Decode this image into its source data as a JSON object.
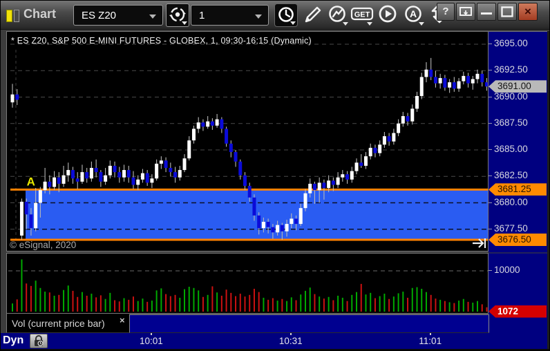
{
  "window": {
    "title": "Chart",
    "controls": {
      "help": "?",
      "close": "×"
    }
  },
  "toolbar": {
    "symbol": "ES Z20",
    "interval": "1",
    "get_label": "GET",
    "auto_label": "A"
  },
  "chart": {
    "title": "* ES Z20, S&P 500 E-MINI FUTURES - GLOBEX, 1, 09:30-16:15 (Dynamic)",
    "copyright": "© eSignal, 2020"
  },
  "volume_pane": {
    "label": "Vol (current price bar)",
    "close_label": "×"
  },
  "timeline": {
    "mode_label": "Dyn"
  },
  "chart_data": {
    "type": "candlestick",
    "symbol": "ES Z20",
    "description": "S&P 500 E-MINI FUTURES - GLOBEX",
    "interval_minutes": 1,
    "session": "09:30-16:15",
    "price_axis": {
      "ticks": [
        "3695.00",
        "3692.50",
        "3690.00",
        "3687.50",
        "3685.00",
        "3682.50",
        "3680.00",
        "3677.50"
      ],
      "tick_values": [
        3695,
        3692.5,
        3690,
        3687.5,
        3685,
        3682.5,
        3680,
        3677.5
      ],
      "last_price": 3691.0,
      "last_price_label": "3691.00"
    },
    "zone": {
      "top": 3681.25,
      "top_label": "3681.25",
      "bottom": 3676.5,
      "bottom_label": "3676.50",
      "fill_color": "#2a5cf2",
      "line_color": "#ff8200"
    },
    "marker": {
      "label": "A",
      "index": 5,
      "price": 3681.9,
      "color": "#e8e800"
    },
    "time_ticks": [
      {
        "label": "10:01",
        "index": 30
      },
      {
        "label": "10:31",
        "index": 60
      },
      {
        "label": "11:01",
        "index": 90
      }
    ],
    "volume_axis": {
      "tick": "10000",
      "tick_value": 10000,
      "last_volume": 1072,
      "last_volume_label": "1072"
    },
    "colors": {
      "up": "#ffffff",
      "down": "#0b0bd8",
      "wick": "#b8b8b8",
      "vol_up": "#00aa00",
      "vol_down": "#cc1111"
    },
    "candles": [
      [
        3689.5,
        3691.25,
        3689.0,
        3690.25,
        2000
      ],
      [
        3690.25,
        3690.75,
        3689.25,
        3689.75,
        3000
      ],
      [
        3676.9,
        3680.4,
        3676.5,
        3680.1,
        12800
      ],
      [
        3680.1,
        3680.4,
        3677.5,
        3678.9,
        6900
      ],
      [
        3678.9,
        3679.5,
        3676.9,
        3677.6,
        6300
      ],
      [
        3677.6,
        3681.4,
        3677.3,
        3680.0,
        7600
      ],
      [
        3680.0,
        3681.5,
        3678.6,
        3681.2,
        5800
      ],
      [
        3681.2,
        3683.3,
        3680.9,
        3682.0,
        4900
      ],
      [
        3682.0,
        3682.6,
        3680.8,
        3681.5,
        4700
      ],
      [
        3681.5,
        3683.0,
        3681.2,
        3682.4,
        3900
      ],
      [
        3682.4,
        3682.9,
        3681.0,
        3681.8,
        4100
      ],
      [
        3681.8,
        3683.5,
        3681.5,
        3682.6,
        5300
      ],
      [
        3682.6,
        3683.8,
        3682.0,
        3683.1,
        6400
      ],
      [
        3683.1,
        3683.4,
        3681.8,
        3682.3,
        5100
      ],
      [
        3682.3,
        3682.9,
        3681.3,
        3682.0,
        3600
      ],
      [
        3682.0,
        3683.6,
        3681.8,
        3682.9,
        4800
      ],
      [
        3682.9,
        3683.3,
        3681.9,
        3682.3,
        3900
      ],
      [
        3682.3,
        3683.9,
        3682.0,
        3683.3,
        4400
      ],
      [
        3683.3,
        3684.1,
        3682.4,
        3682.9,
        3500
      ],
      [
        3682.9,
        3683.1,
        3681.5,
        3682.0,
        4000
      ],
      [
        3682.0,
        3683.3,
        3681.7,
        3682.6,
        3100
      ],
      [
        3682.6,
        3684.0,
        3682.3,
        3683.5,
        4600
      ],
      [
        3683.5,
        3683.9,
        3682.4,
        3682.9,
        2800
      ],
      [
        3682.9,
        3683.4,
        3681.9,
        3682.4,
        2500
      ],
      [
        3682.4,
        3683.6,
        3682.0,
        3683.1,
        3300
      ],
      [
        3683.1,
        3683.5,
        3681.9,
        3682.4,
        2900
      ],
      [
        3682.4,
        3683.0,
        3681.3,
        3681.7,
        3700
      ],
      [
        3681.7,
        3682.6,
        3681.2,
        3682.2,
        2600
      ],
      [
        3682.2,
        3683.2,
        3681.9,
        3682.8,
        3200
      ],
      [
        3682.8,
        3683.1,
        3681.6,
        3681.9,
        2400
      ],
      [
        3681.9,
        3682.7,
        3681.4,
        3682.3,
        2700
      ],
      [
        3682.3,
        3684.1,
        3682.1,
        3683.7,
        5200
      ],
      [
        3683.7,
        3684.4,
        3683.2,
        3684.0,
        5700
      ],
      [
        3684.0,
        3684.3,
        3682.9,
        3683.3,
        4300
      ],
      [
        3683.3,
        3683.8,
        3682.5,
        3682.9,
        3800
      ],
      [
        3682.9,
        3683.4,
        3681.9,
        3682.4,
        4100
      ],
      [
        3682.4,
        3683.5,
        3682.1,
        3683.1,
        3400
      ],
      [
        3683.1,
        3684.6,
        3682.9,
        3684.2,
        5500
      ],
      [
        3684.2,
        3686.3,
        3684.0,
        3685.9,
        6100
      ],
      [
        3685.9,
        3687.3,
        3685.6,
        3687.0,
        5800
      ],
      [
        3687.0,
        3688.1,
        3686.6,
        3687.6,
        5200
      ],
      [
        3687.6,
        3687.9,
        3686.8,
        3687.2,
        3600
      ],
      [
        3687.2,
        3688.2,
        3687.0,
        3687.7,
        4100
      ],
      [
        3687.7,
        3688.0,
        3686.9,
        3687.3,
        6200
      ],
      [
        3687.3,
        3688.4,
        3687.1,
        3687.9,
        4700
      ],
      [
        3687.9,
        3688.1,
        3686.6,
        3687.0,
        3900
      ],
      [
        3687.0,
        3687.2,
        3685.3,
        3685.6,
        5400
      ],
      [
        3685.6,
        3685.9,
        3684.3,
        3684.8,
        4600
      ],
      [
        3684.8,
        3685.0,
        3683.4,
        3683.9,
        3800
      ],
      [
        3683.9,
        3684.1,
        3682.2,
        3682.6,
        4400
      ],
      [
        3682.6,
        3682.9,
        3681.2,
        3681.6,
        3700
      ],
      [
        3681.6,
        3681.9,
        3680.1,
        3680.5,
        4100
      ],
      [
        3680.5,
        3680.8,
        3678.3,
        3678.8,
        5600
      ],
      [
        3678.8,
        3679.1,
        3677.0,
        3677.6,
        4800
      ],
      [
        3677.6,
        3678.6,
        3677.2,
        3678.2,
        3400
      ],
      [
        3678.2,
        3678.5,
        3677.1,
        3677.7,
        2900
      ],
      [
        3677.7,
        3678.0,
        3676.6,
        3677.2,
        3300
      ],
      [
        3677.2,
        3678.3,
        3676.9,
        3677.9,
        2700
      ],
      [
        3677.9,
        3678.1,
        3676.5,
        3677.3,
        3100
      ],
      [
        3677.3,
        3678.4,
        3676.8,
        3678.0,
        2600
      ],
      [
        3678.0,
        3679.0,
        3677.6,
        3678.5,
        3500
      ],
      [
        3678.5,
        3678.8,
        3677.4,
        3678.0,
        2800
      ],
      [
        3678.0,
        3679.9,
        3677.8,
        3679.5,
        4200
      ],
      [
        3679.5,
        3681.3,
        3679.2,
        3680.9,
        5100
      ],
      [
        3680.9,
        3682.3,
        3680.5,
        3681.8,
        5900
      ],
      [
        3681.8,
        3682.0,
        3679.9,
        3681.2,
        4300
      ],
      [
        3681.2,
        3682.4,
        3680.0,
        3681.9,
        3700
      ],
      [
        3681.9,
        3682.2,
        3680.3,
        3681.4,
        3200
      ],
      [
        3681.4,
        3682.6,
        3681.0,
        3682.1,
        3600
      ],
      [
        3682.1,
        3682.4,
        3681.1,
        3681.7,
        2800
      ],
      [
        3681.7,
        3682.9,
        3681.4,
        3682.4,
        3900
      ],
      [
        3682.4,
        3683.1,
        3682.0,
        3682.7,
        3400
      ],
      [
        3682.7,
        3683.0,
        3681.8,
        3682.2,
        2600
      ],
      [
        3682.2,
        3683.4,
        3681.9,
        3683.0,
        4100
      ],
      [
        3683.0,
        3684.2,
        3682.7,
        3683.8,
        4800
      ],
      [
        3683.8,
        3684.6,
        3683.3,
        3683.5,
        6800
      ],
      [
        3683.5,
        3684.8,
        3683.2,
        3684.4,
        4200
      ],
      [
        3684.4,
        3685.6,
        3684.1,
        3685.2,
        4600
      ],
      [
        3685.2,
        3685.5,
        3684.3,
        3684.7,
        3300
      ],
      [
        3684.7,
        3685.9,
        3684.4,
        3685.5,
        3800
      ],
      [
        3685.5,
        3686.7,
        3685.2,
        3686.3,
        4400
      ],
      [
        3686.3,
        3686.6,
        3685.4,
        3685.8,
        3100
      ],
      [
        3685.8,
        3687.0,
        3685.5,
        3686.6,
        3700
      ],
      [
        3686.6,
        3687.9,
        3686.3,
        3687.5,
        4500
      ],
      [
        3687.5,
        3688.6,
        3687.2,
        3688.2,
        4900
      ],
      [
        3688.2,
        3688.5,
        3687.3,
        3687.7,
        3400
      ],
      [
        3687.7,
        3689.3,
        3687.4,
        3688.9,
        5800
      ],
      [
        3688.9,
        3690.5,
        3688.6,
        3690.1,
        6000
      ],
      [
        3690.1,
        3692.3,
        3689.8,
        3691.9,
        5600
      ],
      [
        3691.9,
        3693.3,
        3691.4,
        3692.6,
        4800
      ],
      [
        3692.6,
        3693.7,
        3691.6,
        3691.9,
        4100
      ],
      [
        3691.9,
        3692.5,
        3690.9,
        3691.3,
        3200
      ],
      [
        3691.3,
        3692.2,
        3690.8,
        3691.8,
        2900
      ],
      [
        3691.8,
        3692.1,
        3690.6,
        3690.9,
        2600
      ],
      [
        3690.9,
        3691.7,
        3690.4,
        3691.4,
        2300
      ],
      [
        3691.4,
        3691.9,
        3690.5,
        3690.8,
        2100
      ],
      [
        3690.8,
        3691.8,
        3690.5,
        3691.5,
        2700
      ],
      [
        3691.5,
        3692.4,
        3691.2,
        3692.0,
        3100
      ],
      [
        3692.0,
        3692.3,
        3690.9,
        3691.3,
        2400
      ],
      [
        3691.3,
        3692.0,
        3690.7,
        3691.7,
        2200
      ],
      [
        3691.7,
        3692.6,
        3691.3,
        3692.2,
        2600
      ],
      [
        3692.2,
        3692.5,
        3691.0,
        3691.4,
        1800
      ],
      [
        3691.4,
        3691.8,
        3690.6,
        3691.0,
        1072
      ]
    ]
  }
}
